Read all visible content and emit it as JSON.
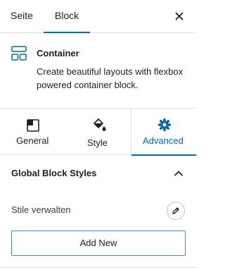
{
  "tabs": [
    {
      "label": "Seite",
      "active": false
    },
    {
      "label": "Block",
      "active": true
    }
  ],
  "close_icon": "close-icon",
  "block": {
    "icon": "container-layout-icon",
    "title": "Container",
    "description": "Create beautiful layouts with flexbox powered container block."
  },
  "panel_tabs": [
    {
      "label": "General",
      "icon": "general-layout-icon",
      "active": false
    },
    {
      "label": "Style",
      "icon": "paint-bucket-icon",
      "active": false
    },
    {
      "label": "Advanced",
      "icon": "gear-icon",
      "active": true
    }
  ],
  "section": {
    "title": "Global Block Styles",
    "expanded": true,
    "manage_label": "Stile verwalten",
    "add_button": "Add New"
  },
  "colors": {
    "accent": "#006ba1",
    "icon_teal": "#2d7f96",
    "button_border": "#4a8db5",
    "divider": "#e0e0e0"
  }
}
